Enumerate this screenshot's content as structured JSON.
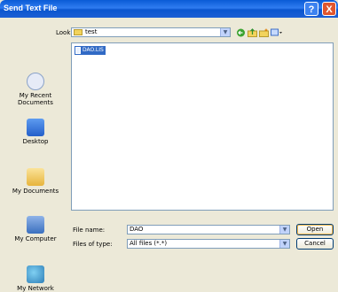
{
  "window": {
    "title": "Send Text File"
  },
  "titlebar_buttons": {
    "help": "?",
    "close": "X"
  },
  "lookin": {
    "label": "Look in:",
    "value": "test"
  },
  "toolbar_icons": [
    "back-icon",
    "up-folder-icon",
    "new-folder-icon",
    "view-menu-icon"
  ],
  "places": [
    {
      "label": "My Recent Documents",
      "icon": "recent-documents-icon"
    },
    {
      "label": "Desktop",
      "icon": "desktop-icon"
    },
    {
      "label": "My Documents",
      "icon": "my-documents-icon"
    },
    {
      "label": "My Computer",
      "icon": "my-computer-icon"
    },
    {
      "label": "My Network",
      "icon": "my-network-icon"
    }
  ],
  "files": [
    {
      "name": "DAO.LIS",
      "selected": true
    }
  ],
  "filename": {
    "label": "File name:",
    "value": "DAO"
  },
  "filetype": {
    "label": "Files of type:",
    "value": "All files (*.*)"
  },
  "buttons": {
    "open": "Open",
    "cancel": "Cancel"
  },
  "colors": {
    "titlebar": "#0a5bd6",
    "selection": "#316ac5",
    "dialog_bg": "#ece9d8"
  }
}
